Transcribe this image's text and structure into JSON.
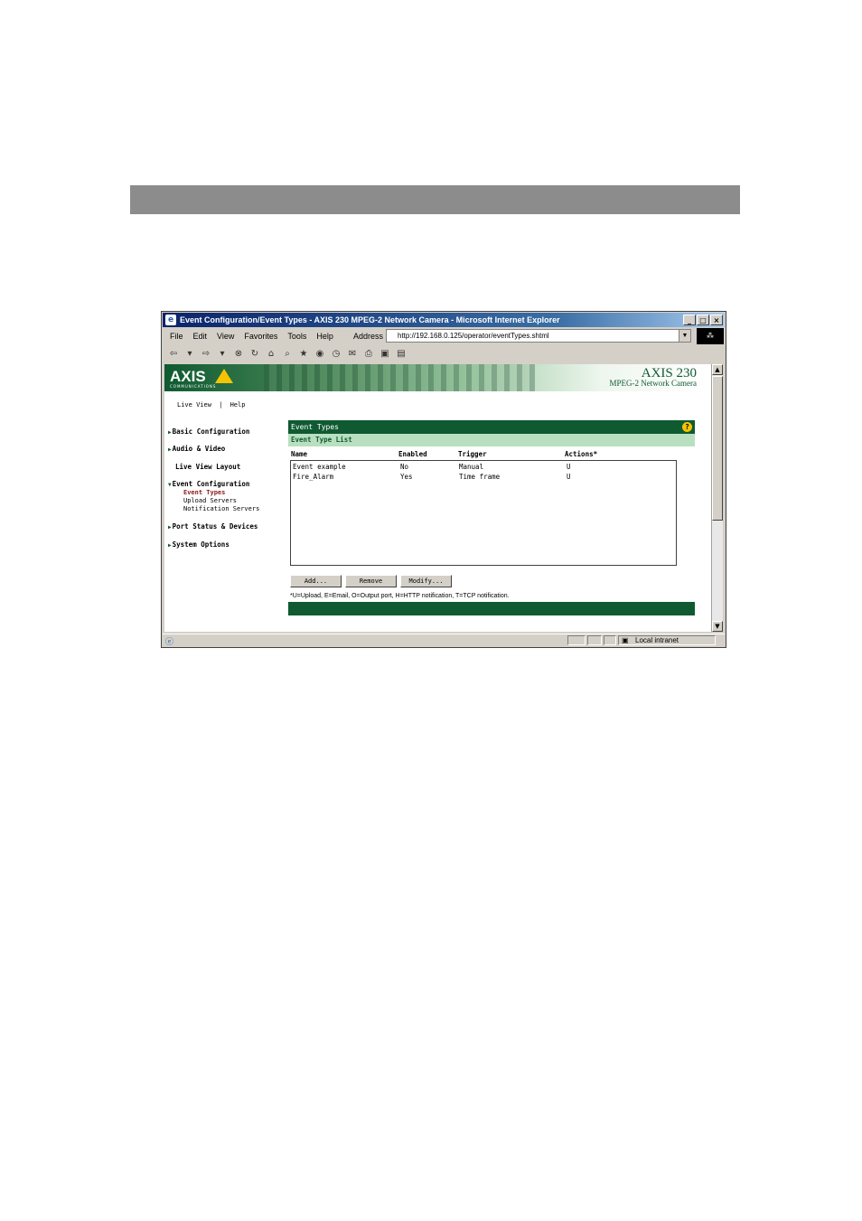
{
  "window": {
    "title": "Event Configuration/Event Types - AXIS 230 MPEG-2 Network Camera - Microsoft Internet Explorer",
    "minimize": "_",
    "maximize": "□",
    "close": "×"
  },
  "menubar": {
    "items": [
      "File",
      "Edit",
      "View",
      "Favorites",
      "Tools",
      "Help"
    ],
    "address_label": "Address",
    "address_value": "http://192.168.0.125/operator/eventTypes.shtml"
  },
  "banner": {
    "brand": "AXIS",
    "brand_sub": "COMMUNICATIONS",
    "model": "AXIS 230",
    "model_sub": "MPEG-2 Network Camera"
  },
  "toplinks": {
    "live_view": "Live View",
    "separator": "|",
    "help": "Help"
  },
  "nav": {
    "basic": "Basic Configuration",
    "audio": "Audio & Video",
    "live_layout": "Live View Layout",
    "event_config": "Event Configuration",
    "event_types": "Event Types",
    "upload_servers": "Upload Servers",
    "notification_servers": "Notification Servers",
    "port_status": "Port Status & Devices",
    "system_options": "System Options"
  },
  "content": {
    "header": "Event Types",
    "help_icon": "?",
    "subheader": "Event Type List",
    "columns": [
      "Name",
      "Enabled",
      "Trigger",
      "Actions*"
    ],
    "rows": [
      {
        "name": "Event example",
        "enabled": "No",
        "trigger": "Manual",
        "actions": "U"
      },
      {
        "name": "Fire_Alarm",
        "enabled": "Yes",
        "trigger": "Time frame",
        "actions": "U"
      }
    ],
    "buttons": {
      "add": "Add...",
      "remove": "Remove",
      "modify": "Modify..."
    },
    "note": "*U=Upload, E=Email, O=Output port, H=HTTP notification, T=TCP notification."
  },
  "statusbar": {
    "zone": "Local intranet"
  },
  "colors": {
    "axis_green": "#0f5a31",
    "light_green": "#b8e0c0",
    "axis_yellow": "#f5c400"
  }
}
